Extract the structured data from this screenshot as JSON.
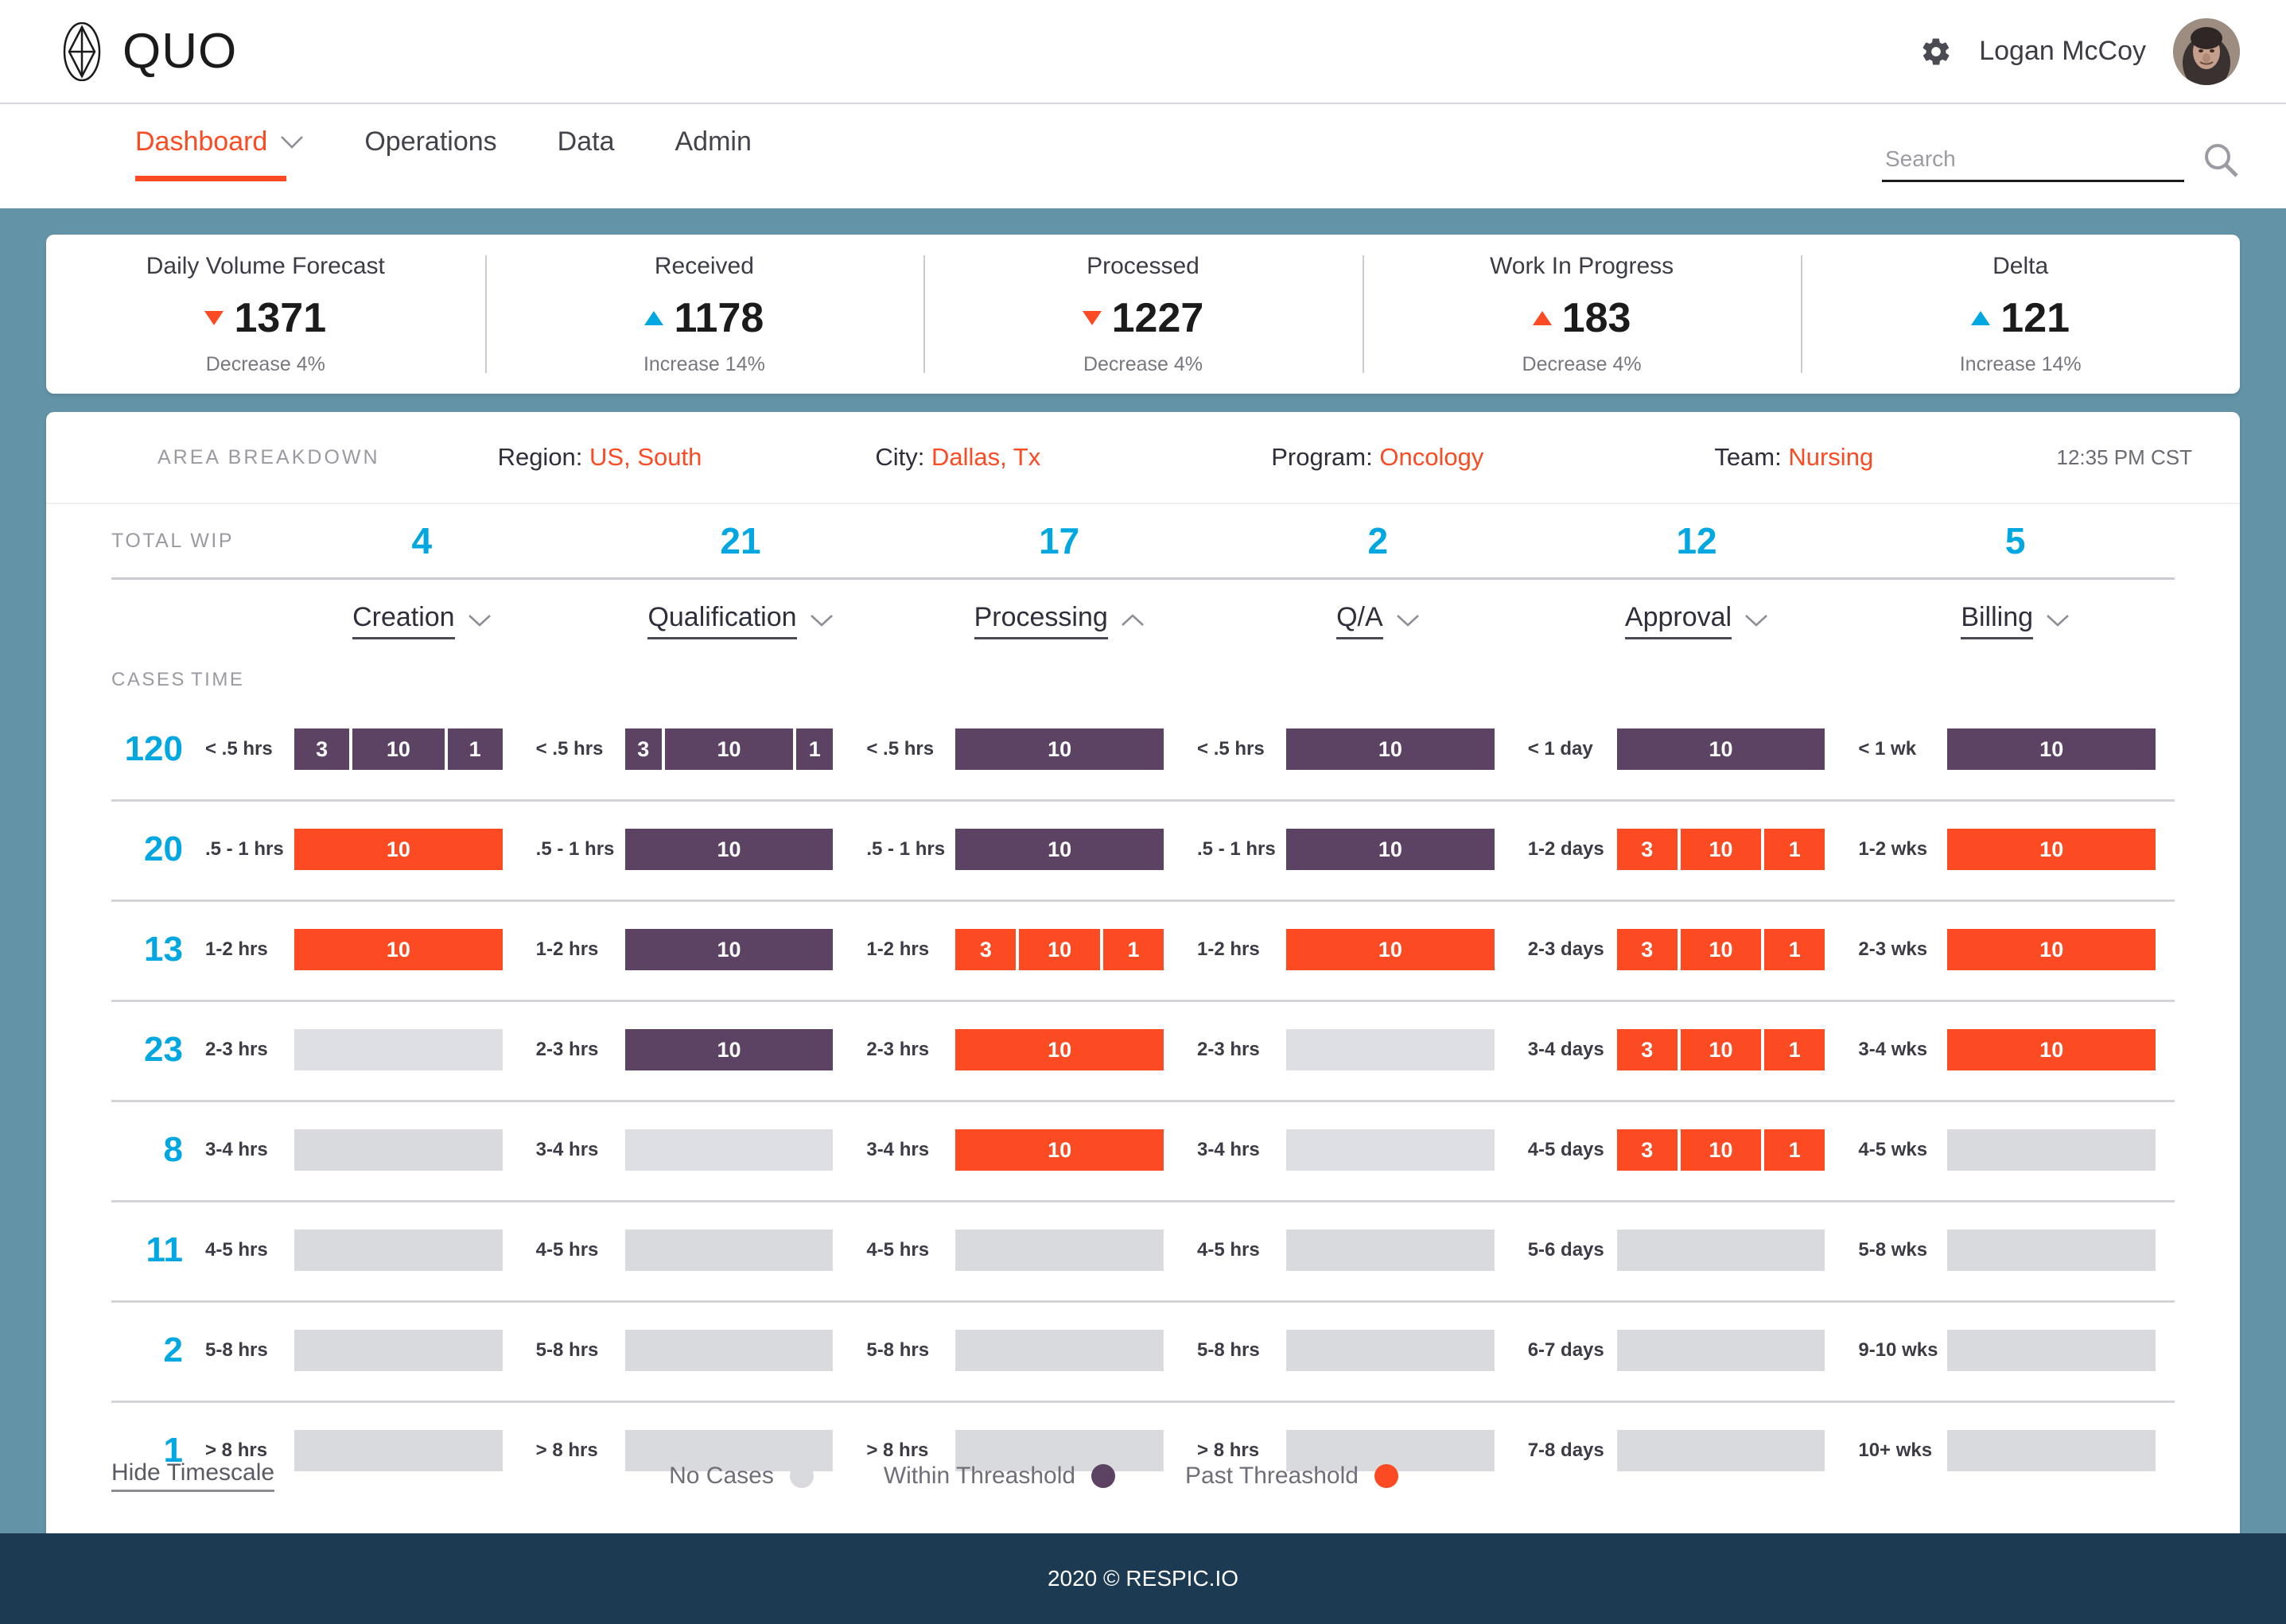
{
  "brand": {
    "name": "QUO",
    "logo_icon": "diamond-logo-icon"
  },
  "topbar": {
    "gear_icon": "gear-icon",
    "user_name": "Logan McCoy",
    "avatar_icon": "avatar"
  },
  "nav": {
    "items": [
      {
        "label": "Dashboard",
        "active": true,
        "caret": true
      },
      {
        "label": "Operations",
        "active": false,
        "caret": false
      },
      {
        "label": "Data",
        "active": false,
        "caret": false
      },
      {
        "label": "Admin",
        "active": false,
        "caret": false
      }
    ],
    "search": {
      "placeholder": "Search",
      "value": "",
      "icon": "search-icon"
    }
  },
  "kpis": [
    {
      "title": "Daily Volume Forecast",
      "value": "1371",
      "direction": "down",
      "sub": "Decrease 4%"
    },
    {
      "title": "Received",
      "value": "1178",
      "direction": "up",
      "sub": "Increase 14%"
    },
    {
      "title": "Processed",
      "value": "1227",
      "direction": "down",
      "sub": "Decrease 4%"
    },
    {
      "title": "Work In Progress",
      "value": "183",
      "direction": "up-red",
      "sub": "Decrease 4%"
    },
    {
      "title": "Delta",
      "value": "121",
      "direction": "up",
      "sub": "Increase 14%"
    }
  ],
  "filters": {
    "section_label": "AREA BREAKDOWN",
    "items": [
      {
        "key": "Region:",
        "value": "US, South"
      },
      {
        "key": "City:",
        "value": "Dallas, Tx"
      },
      {
        "key": "Program:",
        "value": "Oncology"
      },
      {
        "key": "Team:",
        "value": "Nursing"
      }
    ],
    "timestamp": "12:35 PM CST"
  },
  "table": {
    "total_wip_label": "TOTAL WIP",
    "cases_label": "CASES",
    "time_label": "TIME",
    "columns": [
      {
        "name": "Creation",
        "total": "4",
        "caret": "down"
      },
      {
        "name": "Qualification",
        "total": "21",
        "caret": "down"
      },
      {
        "name": "Processing",
        "total": "17",
        "caret": "up"
      },
      {
        "name": "Q/A",
        "total": "2",
        "caret": "down"
      },
      {
        "name": "Approval",
        "total": "12",
        "caret": "down"
      },
      {
        "name": "Billing",
        "total": "5",
        "caret": "down"
      }
    ],
    "rows": [
      {
        "cases": "120",
        "cells": [
          {
            "time": "< .5 hrs",
            "segments": [
              {
                "label": "3",
                "state": "within",
                "flex": 3
              },
              {
                "label": "10",
                "state": "within",
                "flex": 5
              },
              {
                "label": "1",
                "state": "within",
                "flex": 3
              }
            ]
          },
          {
            "time": "< .5 hrs",
            "segments": [
              {
                "label": "3",
                "state": "within",
                "flex": 2
              },
              {
                "label": "10",
                "state": "within",
                "flex": 7
              },
              {
                "label": "1",
                "state": "within",
                "flex": 2
              }
            ]
          },
          {
            "time": "< .5 hrs",
            "segments": [
              {
                "label": "10",
                "state": "within",
                "flex": 1
              }
            ]
          },
          {
            "time": "< .5 hrs",
            "segments": [
              {
                "label": "10",
                "state": "within",
                "flex": 1
              }
            ]
          },
          {
            "time": "< 1 day",
            "segments": [
              {
                "label": "10",
                "state": "within",
                "flex": 1
              }
            ]
          },
          {
            "time": "< 1 wk",
            "segments": [
              {
                "label": "10",
                "state": "within",
                "flex": 1
              }
            ]
          }
        ]
      },
      {
        "cases": "20",
        "cells": [
          {
            "time": ".5 - 1 hrs",
            "segments": [
              {
                "label": "10",
                "state": "past",
                "flex": 1
              }
            ]
          },
          {
            "time": ".5 - 1 hrs",
            "segments": [
              {
                "label": "10",
                "state": "within",
                "flex": 1
              }
            ]
          },
          {
            "time": ".5 - 1 hrs",
            "segments": [
              {
                "label": "10",
                "state": "within",
                "flex": 1
              }
            ]
          },
          {
            "time": ".5 - 1 hrs",
            "segments": [
              {
                "label": "10",
                "state": "within",
                "flex": 1
              }
            ]
          },
          {
            "time": "1-2 days",
            "segments": [
              {
                "label": "3",
                "state": "past",
                "flex": 3
              },
              {
                "label": "10",
                "state": "past",
                "flex": 4
              },
              {
                "label": "1",
                "state": "past",
                "flex": 3
              }
            ]
          },
          {
            "time": "1-2 wks",
            "segments": [
              {
                "label": "10",
                "state": "past",
                "flex": 1
              }
            ]
          }
        ]
      },
      {
        "cases": "13",
        "cells": [
          {
            "time": "1-2 hrs",
            "segments": [
              {
                "label": "10",
                "state": "past",
                "flex": 1
              }
            ]
          },
          {
            "time": "1-2 hrs",
            "segments": [
              {
                "label": "10",
                "state": "within",
                "flex": 1
              }
            ]
          },
          {
            "time": "1-2 hrs",
            "segments": [
              {
                "label": "3",
                "state": "past",
                "flex": 3
              },
              {
                "label": "10",
                "state": "past",
                "flex": 4
              },
              {
                "label": "1",
                "state": "past",
                "flex": 3
              }
            ]
          },
          {
            "time": "1-2 hrs",
            "segments": [
              {
                "label": "10",
                "state": "past",
                "flex": 1
              }
            ]
          },
          {
            "time": "2-3 days",
            "segments": [
              {
                "label": "3",
                "state": "past",
                "flex": 3
              },
              {
                "label": "10",
                "state": "past",
                "flex": 4
              },
              {
                "label": "1",
                "state": "past",
                "flex": 3
              }
            ]
          },
          {
            "time": "2-3 wks",
            "segments": [
              {
                "label": "10",
                "state": "past",
                "flex": 1
              }
            ]
          }
        ]
      },
      {
        "cases": "23",
        "cells": [
          {
            "time": "2-3 hrs",
            "segments": [
              {
                "label": "",
                "state": "empty-lite",
                "flex": 1
              }
            ]
          },
          {
            "time": "2-3 hrs",
            "segments": [
              {
                "label": "10",
                "state": "within",
                "flex": 1
              }
            ]
          },
          {
            "time": "2-3 hrs",
            "segments": [
              {
                "label": "10",
                "state": "past",
                "flex": 1
              }
            ]
          },
          {
            "time": "2-3 hrs",
            "segments": [
              {
                "label": "",
                "state": "empty-lite",
                "flex": 1
              }
            ]
          },
          {
            "time": "3-4 days",
            "segments": [
              {
                "label": "3",
                "state": "past",
                "flex": 3
              },
              {
                "label": "10",
                "state": "past",
                "flex": 4
              },
              {
                "label": "1",
                "state": "past",
                "flex": 3
              }
            ]
          },
          {
            "time": "3-4 wks",
            "segments": [
              {
                "label": "10",
                "state": "past",
                "flex": 1
              }
            ]
          }
        ]
      },
      {
        "cases": "8",
        "cells": [
          {
            "time": "3-4 hrs",
            "segments": [
              {
                "label": "",
                "state": "empty",
                "flex": 1
              }
            ]
          },
          {
            "time": "3-4 hrs",
            "segments": [
              {
                "label": "",
                "state": "empty-lite",
                "flex": 1
              }
            ]
          },
          {
            "time": "3-4 hrs",
            "segments": [
              {
                "label": "10",
                "state": "past",
                "flex": 1
              }
            ]
          },
          {
            "time": "3-4 hrs",
            "segments": [
              {
                "label": "",
                "state": "empty-lite",
                "flex": 1
              }
            ]
          },
          {
            "time": "4-5 days",
            "segments": [
              {
                "label": "3",
                "state": "past",
                "flex": 3
              },
              {
                "label": "10",
                "state": "past",
                "flex": 4
              },
              {
                "label": "1",
                "state": "past",
                "flex": 3
              }
            ]
          },
          {
            "time": "4-5 wks",
            "segments": [
              {
                "label": "",
                "state": "empty",
                "flex": 1
              }
            ]
          }
        ]
      },
      {
        "cases": "11",
        "cells": [
          {
            "time": "4-5 hrs",
            "segments": [
              {
                "label": "",
                "state": "empty",
                "flex": 1
              }
            ]
          },
          {
            "time": "4-5 hrs",
            "segments": [
              {
                "label": "",
                "state": "empty",
                "flex": 1
              }
            ]
          },
          {
            "time": "4-5 hrs",
            "segments": [
              {
                "label": "",
                "state": "empty",
                "flex": 1
              }
            ]
          },
          {
            "time": "4-5 hrs",
            "segments": [
              {
                "label": "",
                "state": "empty",
                "flex": 1
              }
            ]
          },
          {
            "time": "5-6 days",
            "segments": [
              {
                "label": "",
                "state": "empty",
                "flex": 1
              }
            ]
          },
          {
            "time": "5-8 wks",
            "segments": [
              {
                "label": "",
                "state": "empty",
                "flex": 1
              }
            ]
          }
        ]
      },
      {
        "cases": "2",
        "cells": [
          {
            "time": "5-8 hrs",
            "segments": [
              {
                "label": "",
                "state": "empty",
                "flex": 1
              }
            ]
          },
          {
            "time": "5-8 hrs",
            "segments": [
              {
                "label": "",
                "state": "empty",
                "flex": 1
              }
            ]
          },
          {
            "time": "5-8 hrs",
            "segments": [
              {
                "label": "",
                "state": "empty",
                "flex": 1
              }
            ]
          },
          {
            "time": "5-8 hrs",
            "segments": [
              {
                "label": "",
                "state": "empty",
                "flex": 1
              }
            ]
          },
          {
            "time": "6-7 days",
            "segments": [
              {
                "label": "",
                "state": "empty",
                "flex": 1
              }
            ]
          },
          {
            "time": "9-10 wks",
            "segments": [
              {
                "label": "",
                "state": "empty",
                "flex": 1
              }
            ]
          }
        ]
      },
      {
        "cases": "1",
        "cells": [
          {
            "time": "> 8 hrs",
            "segments": [
              {
                "label": "",
                "state": "empty",
                "flex": 1
              }
            ]
          },
          {
            "time": "> 8 hrs",
            "segments": [
              {
                "label": "",
                "state": "empty",
                "flex": 1
              }
            ]
          },
          {
            "time": "> 8 hrs",
            "segments": [
              {
                "label": "",
                "state": "empty",
                "flex": 1
              }
            ]
          },
          {
            "time": "> 8 hrs",
            "segments": [
              {
                "label": "",
                "state": "empty",
                "flex": 1
              }
            ]
          },
          {
            "time": "7-8 days",
            "segments": [
              {
                "label": "",
                "state": "empty",
                "flex": 1
              }
            ]
          },
          {
            "time": "10+ wks",
            "segments": [
              {
                "label": "",
                "state": "empty",
                "flex": 1
              }
            ]
          }
        ]
      }
    ]
  },
  "legend": {
    "hide_timescale": "Hide Timescale",
    "items": [
      {
        "label": "No Cases",
        "color": "#d9dadd"
      },
      {
        "label": "Within Threashold",
        "color": "#5c4263"
      },
      {
        "label": "Past Threashold",
        "color": "#fc4a23"
      }
    ]
  },
  "footer": {
    "text": "2020 © RESPIC.IO"
  },
  "colors": {
    "accent_orange": "#fc4a23",
    "accent_blue": "#00a7e1",
    "purple": "#5c4263",
    "page_bg": "#6393a6",
    "footer_bg": "#1c3a52",
    "empty_gray": "#d9dadd"
  }
}
